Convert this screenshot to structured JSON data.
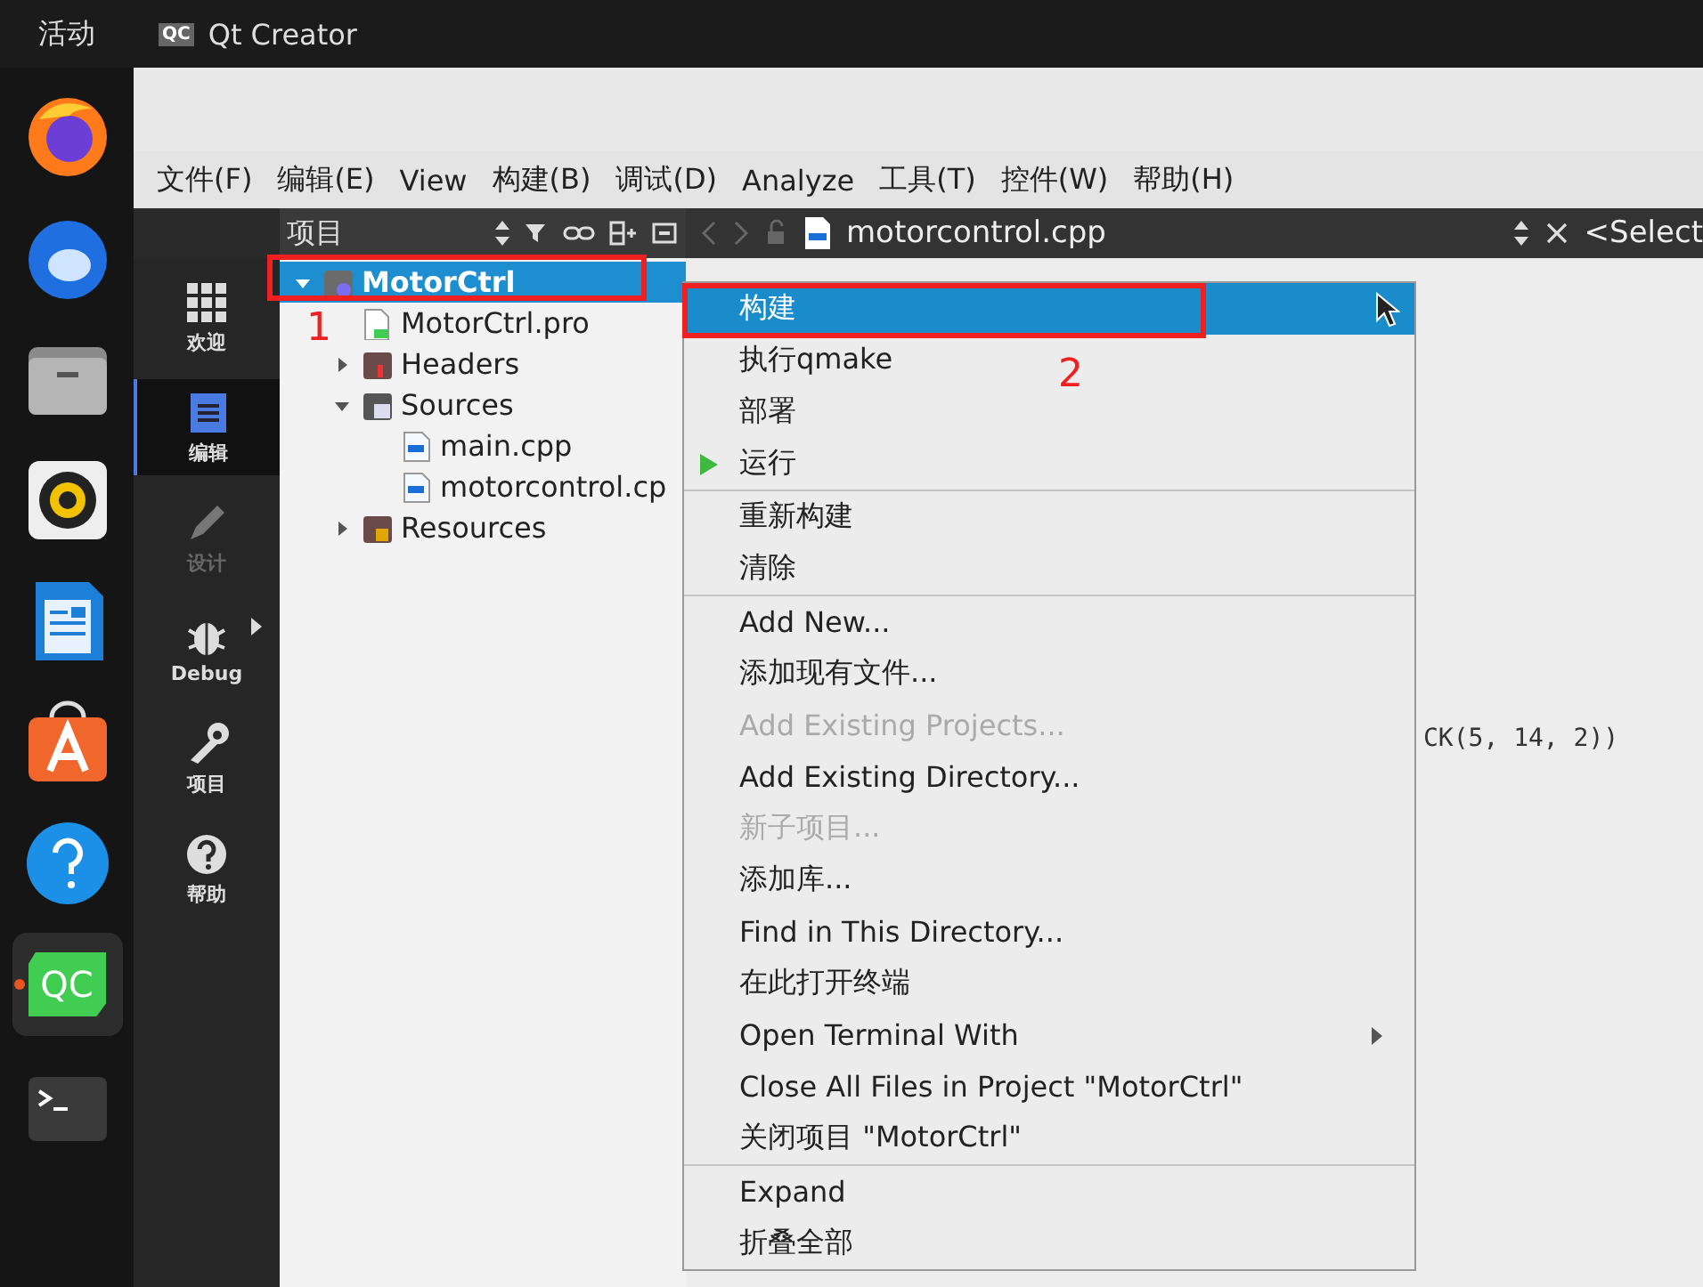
{
  "top_bar": {
    "activities": "活动",
    "logo_text": "QC",
    "app_name": "Qt Creator"
  },
  "dock": {
    "items": [
      {
        "kind": "firefox",
        "running": false
      },
      {
        "kind": "thunderbird",
        "running": false
      },
      {
        "kind": "files",
        "running": false
      },
      {
        "kind": "rhythmbox",
        "running": false
      },
      {
        "kind": "writer",
        "running": false
      },
      {
        "kind": "store",
        "running": false
      },
      {
        "kind": "help",
        "running": false
      },
      {
        "kind": "qtcreator",
        "running": true,
        "icon_text": "QC"
      },
      {
        "kind": "terminal",
        "running": false
      }
    ]
  },
  "menu_bar": [
    "文件(F)",
    "编辑(E)",
    "View",
    "构建(B)",
    "调试(D)",
    "Analyze",
    "工具(T)",
    "控件(W)",
    "帮助(H)"
  ],
  "mode_bar": [
    {
      "kind": "welcome",
      "label": "欢迎",
      "selected": false,
      "disabled": false
    },
    {
      "kind": "edit",
      "label": "编辑",
      "selected": true,
      "disabled": false
    },
    {
      "kind": "design",
      "label": "设计",
      "selected": false,
      "disabled": true
    },
    {
      "kind": "debug",
      "label": "Debug",
      "selected": false,
      "disabled": false
    },
    {
      "kind": "projects",
      "label": "项目",
      "selected": false,
      "disabled": false
    },
    {
      "kind": "help",
      "label": "帮助",
      "selected": false,
      "disabled": false
    }
  ],
  "project_panel": {
    "title": "项目",
    "tree": [
      {
        "kind": "project",
        "label": "MotorCtrl",
        "selected": true,
        "expanded": true,
        "children": [
          {
            "kind": "pro",
            "label": "MotorCtrl.pro",
            "selected": false
          },
          {
            "kind": "headers",
            "label": "Headers",
            "selected": false,
            "expanded": false
          },
          {
            "kind": "sources",
            "label": "Sources",
            "selected": false,
            "expanded": true,
            "children": [
              {
                "kind": "cpp",
                "label": "main.cpp",
                "selected": false
              },
              {
                "kind": "cpp",
                "label": "motorcontrol.cp",
                "selected": false
              }
            ]
          },
          {
            "kind": "resources",
            "label": "Resources",
            "selected": false,
            "expanded": false
          }
        ]
      }
    ]
  },
  "editor": {
    "tab": "motorcontrol.cpp",
    "symbol_selector": "<Select",
    "code_line": "CK(5, 14, 2))"
  },
  "context_menu": {
    "groups": [
      [
        {
          "label": "构建",
          "kind": "plain",
          "selected": true,
          "disabled": false,
          "submenu": false
        },
        {
          "label": "执行qmake",
          "kind": "plain",
          "selected": false,
          "disabled": false,
          "submenu": false
        },
        {
          "label": "部署",
          "kind": "plain",
          "selected": false,
          "disabled": false,
          "submenu": false
        },
        {
          "label": "运行",
          "kind": "run",
          "selected": false,
          "disabled": false,
          "submenu": false
        }
      ],
      [
        {
          "label": "重新构建",
          "kind": "plain",
          "selected": false,
          "disabled": false,
          "submenu": false
        },
        {
          "label": "清除",
          "kind": "plain",
          "selected": false,
          "disabled": false,
          "submenu": false
        }
      ],
      [
        {
          "label": "Add New...",
          "kind": "plain",
          "selected": false,
          "disabled": false,
          "submenu": false
        },
        {
          "label": "添加现有文件...",
          "kind": "plain",
          "selected": false,
          "disabled": false,
          "submenu": false
        },
        {
          "label": "Add Existing Projects...",
          "kind": "plain",
          "selected": false,
          "disabled": true,
          "submenu": false
        },
        {
          "label": "Add Existing Directory...",
          "kind": "plain",
          "selected": false,
          "disabled": false,
          "submenu": false
        },
        {
          "label": "新子项目...",
          "kind": "plain",
          "selected": false,
          "disabled": true,
          "submenu": false
        },
        {
          "label": "添加库...",
          "kind": "plain",
          "selected": false,
          "disabled": false,
          "submenu": false
        },
        {
          "label": "Find in This Directory...",
          "kind": "plain",
          "selected": false,
          "disabled": false,
          "submenu": false
        },
        {
          "label": "在此打开终端",
          "kind": "plain",
          "selected": false,
          "disabled": false,
          "submenu": false
        },
        {
          "label": "Open Terminal With",
          "kind": "plain",
          "selected": false,
          "disabled": false,
          "submenu": true
        },
        {
          "label": "Close All Files in Project \"MotorCtrl\"",
          "kind": "plain",
          "selected": false,
          "disabled": false,
          "submenu": false
        },
        {
          "label": "关闭项目 \"MotorCtrl\"",
          "kind": "plain",
          "selected": false,
          "disabled": false,
          "submenu": false
        }
      ],
      [
        {
          "label": "Expand",
          "kind": "plain",
          "selected": false,
          "disabled": false,
          "submenu": false
        },
        {
          "label": "折叠全部",
          "kind": "plain",
          "selected": false,
          "disabled": false,
          "submenu": false
        }
      ]
    ]
  },
  "annotations": [
    {
      "label": "1"
    },
    {
      "label": "2"
    }
  ]
}
